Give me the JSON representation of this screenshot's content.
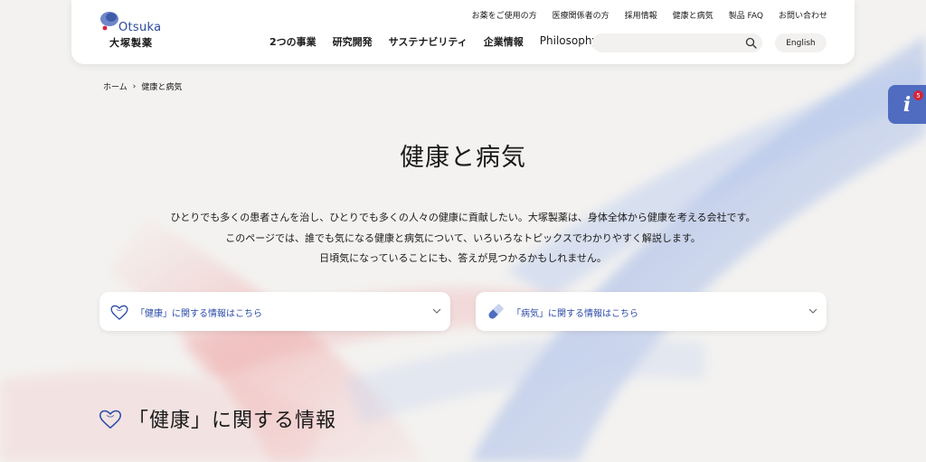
{
  "logo": {
    "en": "Otsuka",
    "jp": "大塚製薬"
  },
  "util_nav": [
    "お薬をご使用の方",
    "医療関係者の方",
    "採用情報",
    "健康と病気",
    "製品 FAQ",
    "お問い合わせ"
  ],
  "main_nav": [
    "2つの事業",
    "研究開発",
    "サステナビリティ",
    "企業情報",
    "Philosophy"
  ],
  "search": {
    "value": "",
    "placeholder": ""
  },
  "lang_button": "English",
  "breadcrumb": {
    "home": "ホーム",
    "separator": "›",
    "current": "健康と病気"
  },
  "info_widget": {
    "glyph": "i",
    "badge": "5"
  },
  "page_title": "健康と病気",
  "intro": [
    "ひとりでも多くの患者さんを治し、ひとりでも多くの人々の健康に貢献したい。大塚製薬は、身体全体から健康を考える会社です。",
    "このページでは、誰でも気になる健康と病気について、いろいろなトピックスでわかりやすく解説します。",
    "日頃気になっていることにも、答えが見つかるかもしれません。"
  ],
  "accordions": [
    {
      "label": "「健康」に関する情報はこちら",
      "icon": "heart-outline-icon"
    },
    {
      "label": "「病気」に関する情報はこちら",
      "icon": "capsule-icon"
    }
  ],
  "section": {
    "title": "「健康」に関する情報",
    "icon": "heart-outline-icon"
  },
  "colors": {
    "accent_blue": "#2a4aa8",
    "info_button": "#4f6cc0",
    "badge_red": "#d6243a",
    "background": "#f3f2f0"
  }
}
